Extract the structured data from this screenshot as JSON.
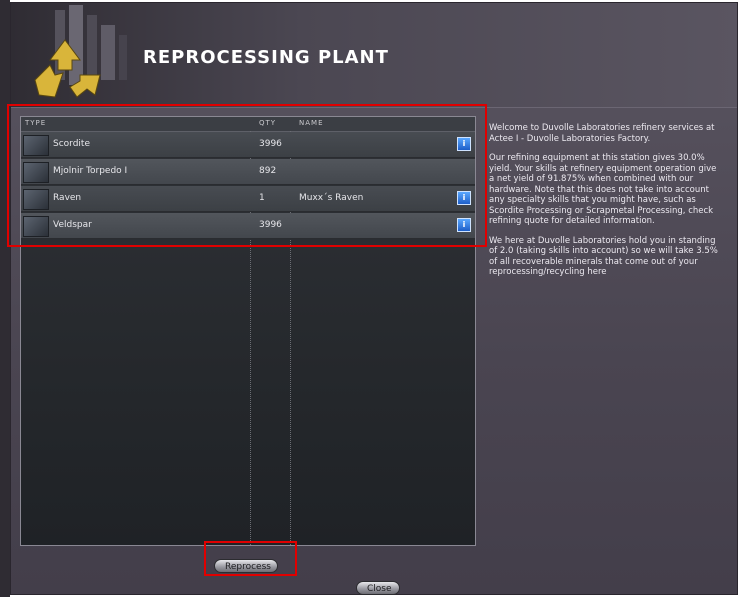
{
  "window": {
    "title": "REPROCESSING PLANT"
  },
  "table": {
    "columns": [
      "TYPE",
      "QTY",
      "NAME"
    ],
    "rows": [
      {
        "type": "Scordite",
        "qty": "3996",
        "name": "",
        "icon": "ore-icon"
      },
      {
        "type": "Mjolnir Torpedo I",
        "qty": "892",
        "name": "",
        "icon": "torpedo-icon"
      },
      {
        "type": "Raven",
        "qty": "1",
        "name": "Muxx´s Raven",
        "icon": "ship-icon"
      },
      {
        "type": "Veldspar",
        "qty": "3996",
        "name": "",
        "icon": "ore-icon"
      }
    ],
    "info_icon": "info-icon"
  },
  "description": {
    "p1": "Welcome to Duvolle Laboratories refinery services at Actee I - Duvolle Laboratories Factory.",
    "p2": "Our refining equipment at this station gives 30.0% yield. Your skills at refinery equipment operation give a net yield of 91.875% when combined with our hardware. Note that this does not take into account any specialty skills that you might have, such as Scordite Processing or Scrapmetal Processing, check refining quote for detailed information.",
    "p3": "We here at Duvolle Laboratories hold you in standing of 2.0 (taking skills into account) so we will take 3.5% of all recoverable minerals that come out of your reprocessing/recycling here"
  },
  "buttons": {
    "reprocess": "Reprocess",
    "close": "Close"
  },
  "colors": {
    "highlight": "#e00000",
    "info_blue": "#1d5ec8"
  }
}
